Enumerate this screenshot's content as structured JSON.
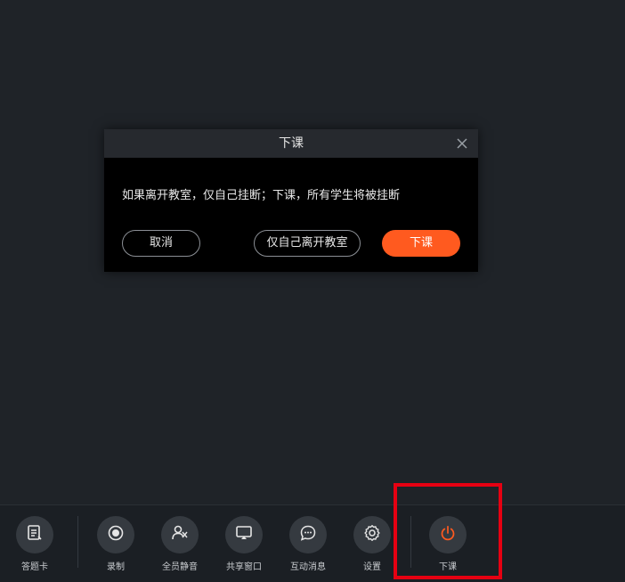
{
  "dialog": {
    "title": "下课",
    "message": "如果离开教室，仅自己挂断；下课，所有学生将被挂断",
    "cancel_label": "取消",
    "leave_label": "仅自己离开教室",
    "end_label": "下课"
  },
  "toolbar": {
    "items": [
      {
        "label": "答题卡",
        "icon": "answer-card-icon"
      },
      {
        "label": "录制",
        "icon": "record-icon"
      },
      {
        "label": "全员静音",
        "icon": "mute-all-icon"
      },
      {
        "label": "共享窗口",
        "icon": "share-window-icon"
      },
      {
        "label": "互动消息",
        "icon": "chat-icon"
      },
      {
        "label": "设置",
        "icon": "gear-icon"
      },
      {
        "label": "下课",
        "icon": "power-icon"
      }
    ]
  },
  "colors": {
    "background": "#1f2328",
    "accent": "#ff5a1f",
    "highlight": "#e60012"
  }
}
